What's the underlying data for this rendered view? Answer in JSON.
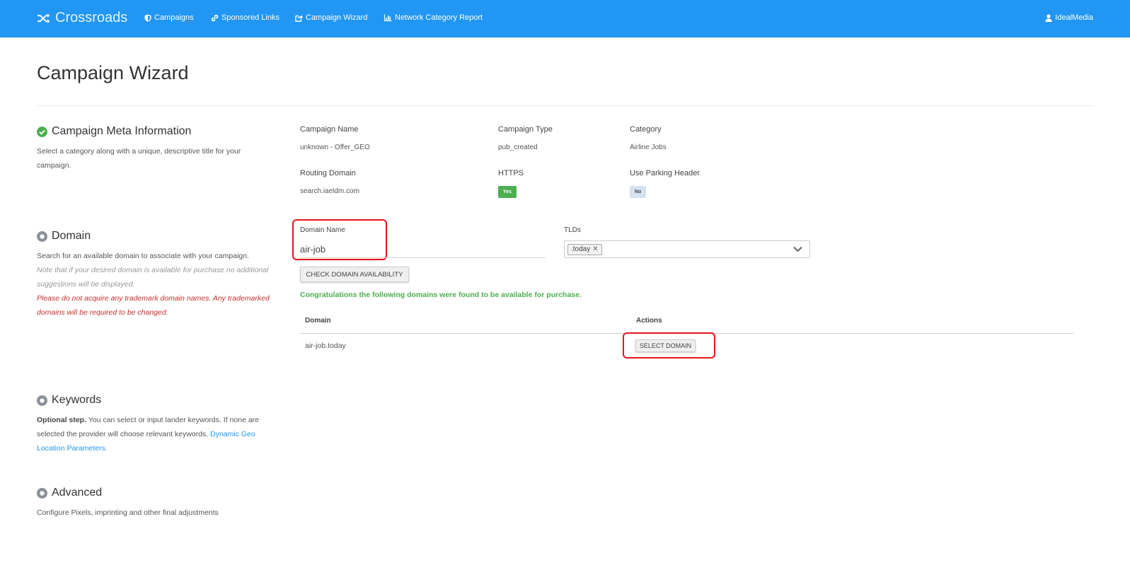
{
  "nav": {
    "brand": "Crossroads",
    "items": [
      {
        "label": "Campaigns",
        "icon": "shield-icon"
      },
      {
        "label": "Sponsored Links",
        "icon": "link-icon"
      },
      {
        "label": "Campaign Wizard",
        "icon": "share-square-icon"
      },
      {
        "label": "Network Category Report",
        "icon": "bar-chart-icon"
      }
    ],
    "user": "IdealMedia"
  },
  "page": {
    "title": "Campaign Wizard"
  },
  "sections": {
    "meta": {
      "title": "Campaign Meta Information",
      "description": "Select a category along with a unique, descriptive title for your campaign.",
      "status_icon": "check-circle-icon",
      "status_color": "#4caf50"
    },
    "domain": {
      "title": "Domain",
      "description": "Search for an available domain to associate with your campaign.",
      "note": "Note that if your desired domain is available for purchase no additional suggestions will be displayed.",
      "warning": "Please do not acquire any trademark domain names. Any trademarked domains will be required to be changed."
    },
    "keywords": {
      "title": "Keywords",
      "optional": "Optional step.",
      "description": "You can select or input lander keywords. If none are selected the provider will choose relevant keywords.",
      "link": "Dynamic Geo Location Parameters."
    },
    "advanced": {
      "title": "Advanced",
      "description": "Configure Pixels, imprinting and other final adjustments"
    }
  },
  "meta_fields": {
    "campaign_name": {
      "label": "Campaign Name",
      "value": "unknown - Offer_GEO"
    },
    "campaign_type": {
      "label": "Campaign Type",
      "value": "pub_created"
    },
    "category": {
      "label": "Category",
      "value": "Airline Jobs"
    },
    "routing_domain": {
      "label": "Routing Domain",
      "value": "search.iaeldm.com"
    },
    "https": {
      "label": "HTTPS",
      "value": "Yes"
    },
    "parking_header": {
      "label": "Use Parking Header",
      "value": "No"
    }
  },
  "domain_form": {
    "name_label": "Domain Name",
    "name_value": "air-job",
    "tlds_label": "TLDs",
    "tld_selected": ".today",
    "check_button": "CHECK DOMAIN AVAILABILITY",
    "success_message": "Congratulations the following domains were found to be available for purchase."
  },
  "results_table": {
    "columns": [
      "Domain",
      "Actions"
    ],
    "rows": [
      {
        "domain": "air-job.today",
        "action": "SELECT DOMAIN"
      }
    ]
  },
  "colors": {
    "navbar": "#2196f3",
    "success": "#4caf50",
    "danger": "#c9302c",
    "highlight": "#e8141b",
    "link": "#2196f3"
  }
}
